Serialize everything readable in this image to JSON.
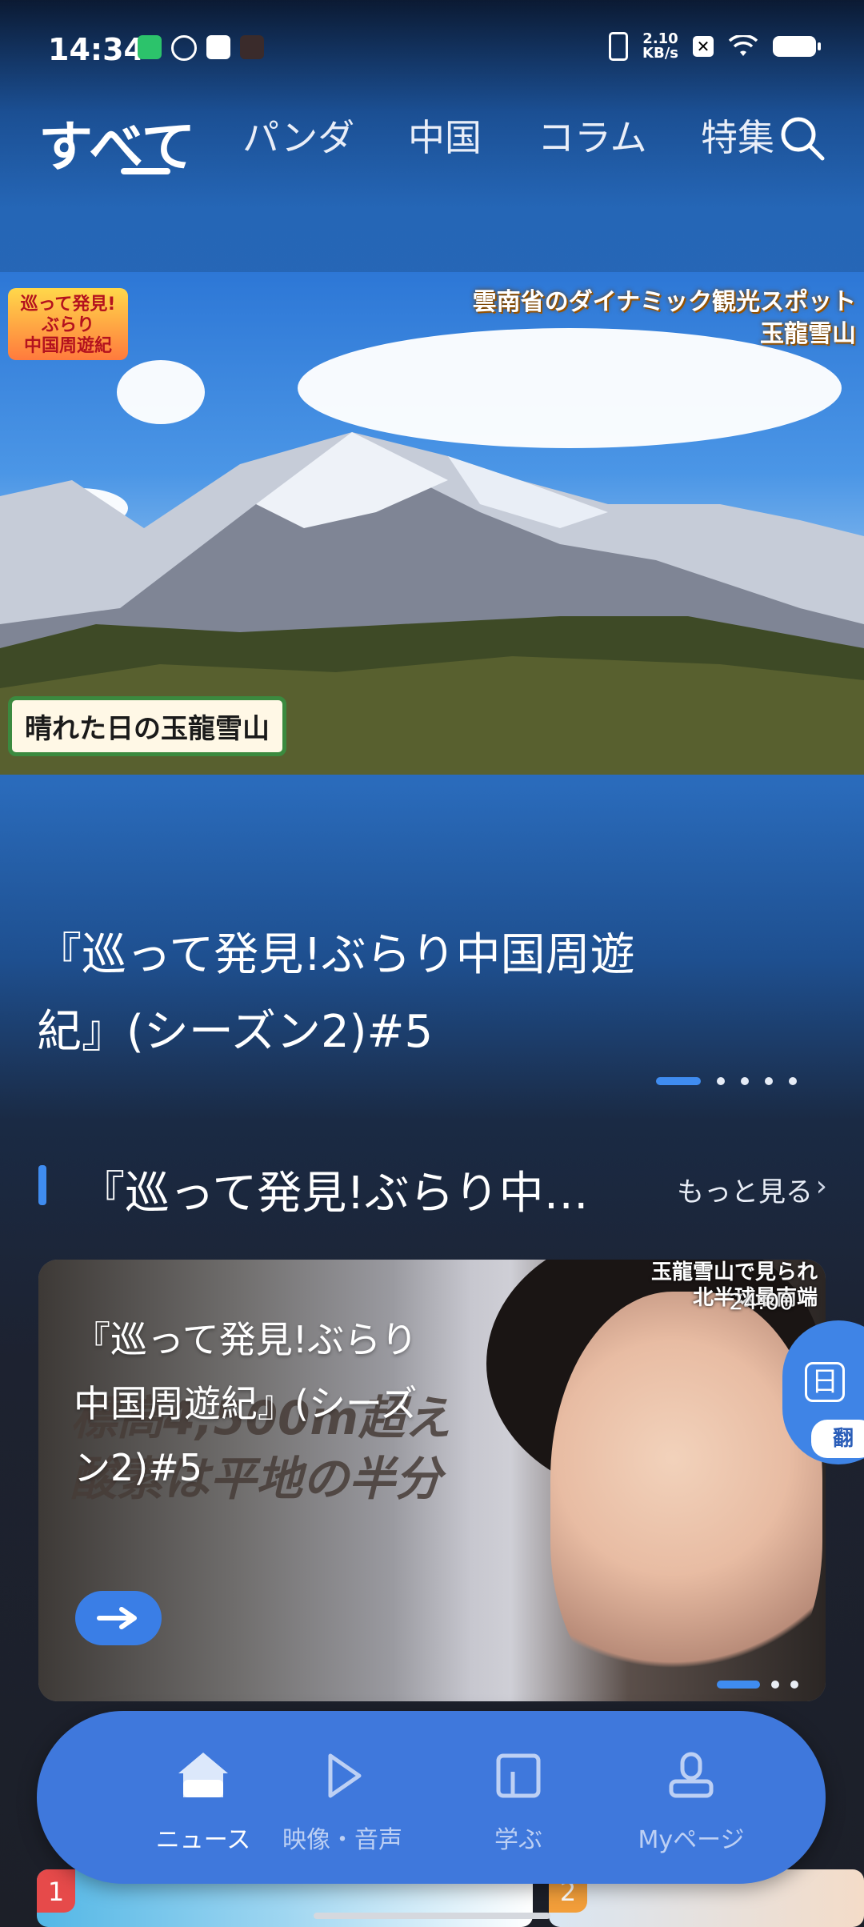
{
  "status_bar": {
    "time": "14:34",
    "net_speed_value": "2.10",
    "net_speed_unit": "KB/s",
    "x_label": "✕"
  },
  "tabs": [
    {
      "label": "すべて",
      "active": true
    },
    {
      "label": "パンダ"
    },
    {
      "label": "中国"
    },
    {
      "label": "コラム"
    },
    {
      "label": "特集"
    }
  ],
  "hero": {
    "caption_line1": "雲南省のダイナミック観光スポット",
    "caption_line2": "玉龍雪山",
    "logo_line1": "巡って発見!",
    "logo_line2": "ぶらり",
    "logo_line3": "中国周遊紀",
    "sign_text": "晴れた日の玉龍雪山",
    "title_line1": "『巡って発見!ぶらり中国周遊",
    "title_line2": "紀』(シーズン2)#5",
    "pager_count": 5
  },
  "section": {
    "title": "『巡って発見!ぶらり中…",
    "more_label": "もっと見る"
  },
  "card": {
    "title_line1": "『巡って発見!ぶらり",
    "title_line2": "中国周遊紀』(シーズ",
    "title_line3": "ン2)#5",
    "overlay_line1": "標高4,500m超え",
    "overlay_line2": "酸素は平地の半分",
    "top_caption_line1": "玉龍雪山で見られ",
    "top_caption_line2": "北半球最南端",
    "duration": "24:00"
  },
  "float_button": {
    "icon_char": "日",
    "label": "翻"
  },
  "bottom_nav": [
    {
      "label": "ニュース",
      "icon": "home-icon",
      "active": true
    },
    {
      "label": "映像・音声",
      "icon": "play-icon"
    },
    {
      "label": "学ぶ",
      "icon": "book-icon"
    },
    {
      "label": "Myページ",
      "icon": "user-icon"
    }
  ],
  "peek_cards": [
    {
      "rank": "1"
    },
    {
      "rank": "2"
    }
  ],
  "colors": {
    "accent": "#3f8cf0",
    "nav_bg": "#3f78dc"
  }
}
